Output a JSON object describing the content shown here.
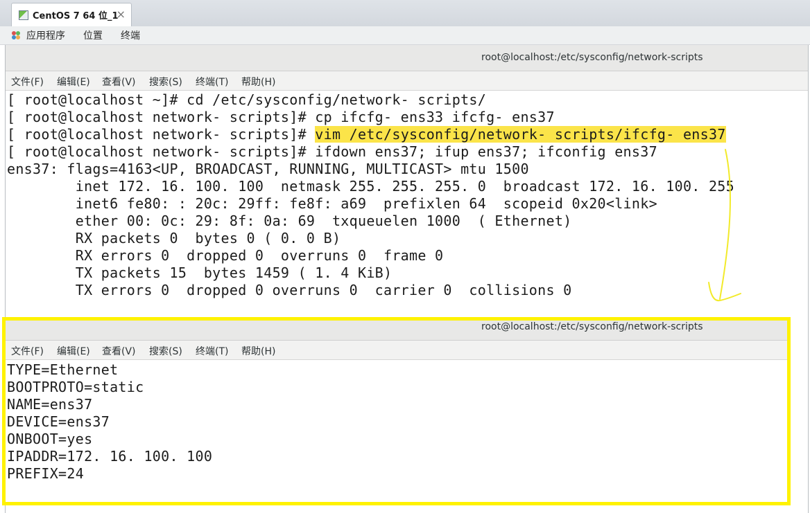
{
  "vm_tab": {
    "title": "CentOS 7 64 位_1",
    "close": "×"
  },
  "gnome_bar": {
    "items": [
      "应用程序",
      "位置",
      "终端"
    ]
  },
  "terminal": {
    "title": "root@localhost:/etc/sysconfig/network-scripts",
    "menu": [
      "文件(F)",
      "编辑(E)",
      "查看(V)",
      "搜索(S)",
      "终端(T)",
      "帮助(H)"
    ],
    "lines": [
      "[ root@localhost ~]# cd /etc/sysconfig/network- scripts/",
      "[ root@localhost network- scripts]# cp ifcfg- ens33 ifcfg- ens37",
      "[ root@localhost network- scripts]# ",
      "[ root@localhost network- scripts]# ifdown ens37; ifup ens37; ifconfig ens37",
      "ens37: flags=4163<UP, BROADCAST, RUNNING, MULTICAST> mtu 1500",
      "        inet 172. 16. 100. 100  netmask 255. 255. 255. 0  broadcast 172. 16. 100. 255",
      "        inet6 fe80: : 20c: 29ff: fe8f: a69  prefixlen 64  scopeid 0x20<link>",
      "        ether 00: 0c: 29: 8f: 0a: 69  txqueuelen 1000  ( Ethernet)",
      "        RX packets 0  bytes 0 ( 0. 0 B)",
      "        RX errors 0  dropped 0  overruns 0  frame 0",
      "        TX packets 15  bytes 1459 ( 1. 4 KiB)",
      "        TX errors 0  dropped 0 overruns 0  carrier 0  collisions 0"
    ],
    "highlighted_command": "vim /etc/sysconfig/network- scripts/ifcfg- ens37"
  },
  "editor": {
    "title": "root@localhost:/etc/sysconfig/network-scripts",
    "menu": [
      "文件(F)",
      "编辑(E)",
      "查看(V)",
      "搜索(S)",
      "终端(T)",
      "帮助(H)"
    ],
    "lines": [
      "TYPE=Ethernet",
      "BOOTPROTO=static",
      "NAME=ens37",
      "DEVICE=ens37",
      "ONBOOT=yes",
      "IPADDR=172. 16. 100. 100",
      "PREFIX=24"
    ]
  },
  "colors": {
    "highlight": "#fbe449",
    "annotation_box": "#fff200"
  }
}
